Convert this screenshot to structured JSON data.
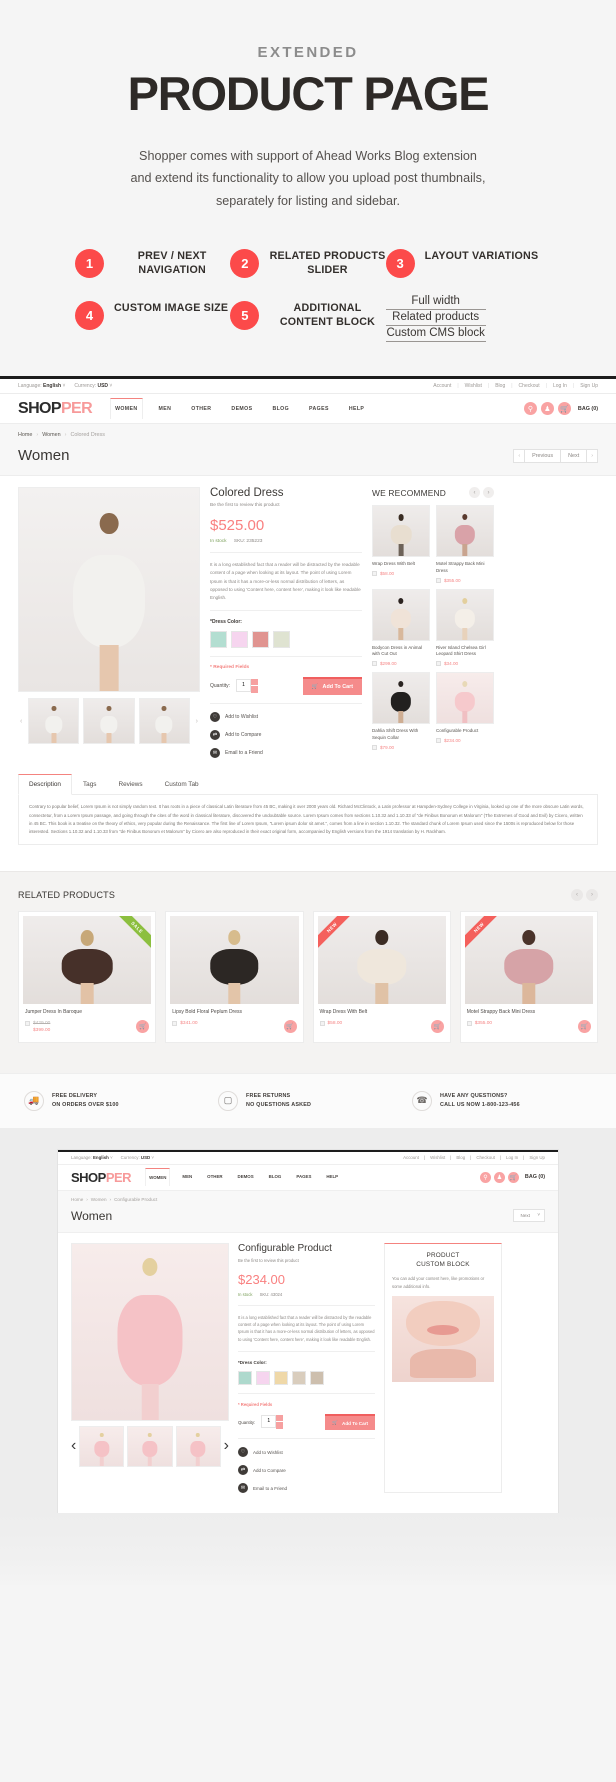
{
  "promo": {
    "kicker": "EXTENDED",
    "title": "PRODUCT PAGE",
    "subtitle_line1": "Shopper comes with support of Ahead Works Blog extension",
    "subtitle_line2": "and extend its functionality to allow you upload post thumbnails,",
    "subtitle_line3": "separately for listing and sidebar.",
    "features": [
      {
        "num": "1",
        "label": "PREV / NEXT NAVIGATION"
      },
      {
        "num": "2",
        "label": "RELATED PRODUCTS SLIDER"
      },
      {
        "num": "3",
        "label": "LAYOUT VARIATIONS"
      },
      {
        "num": "4",
        "label": "CUSTOM IMAGE SIZE"
      },
      {
        "num": "5",
        "label": "ADDITIONAL CONTENT BLOCK"
      }
    ],
    "layout_links": [
      "Full width",
      "Related products",
      "Custom CMS block"
    ],
    "accent_color": "#fc4a4a"
  },
  "shop": {
    "topbar": {
      "language_label": "Language:",
      "language_value": "English",
      "currency_label": "Currency:",
      "currency_value": "USD",
      "links": [
        "Account",
        "Wishlist",
        "Blog",
        "Checkout",
        "Log In",
        "Sign Up"
      ]
    },
    "logo_first": "SHOP",
    "logo_second": "PER",
    "nav": [
      "WOMEN",
      "MEN",
      "OTHER",
      "DEMOS",
      "BLOG",
      "PAGES",
      "HELP"
    ],
    "nav_active": "WOMEN",
    "header_icons": [
      "search-icon",
      "user-icon",
      "cart-icon"
    ],
    "bag_label": "BAG (0)",
    "breadcrumb": [
      "Home",
      "Women",
      "Colored Dress"
    ],
    "page_title": "Women",
    "pager": {
      "prev": "Previous",
      "next": "Next"
    },
    "product": {
      "name": "Colored Dress",
      "review_link": "Be the first to review this product",
      "price": "$525.00",
      "stock": "In stock",
      "sku": "SKU: 235223",
      "description": "It is a long established fact that a reader will be distracted by the readable content of a page when looking at its layout. The point of using Lorem Ipsum is that it has a more-or-less normal distribution of letters, as opposed to using 'Content here, content here', making it look like readable English.",
      "color_label": "*Dress Color:",
      "colors": [
        "#b3ded1",
        "#f6d5ef",
        "#e09490",
        "#dfe3d1"
      ],
      "required_note": "* Required Fields",
      "qty_label": "Quantity:",
      "qty_value": "1",
      "add_to_cart": "Add To Cart",
      "links": [
        {
          "icon": "heart-icon",
          "label": "Add to Wishlist"
        },
        {
          "icon": "compare-icon",
          "label": "Add to Compare"
        },
        {
          "icon": "mail-icon",
          "label": "Email to a Friend"
        }
      ]
    },
    "recommend": {
      "title": "WE RECOMMEND",
      "items": [
        {
          "name": "Wrap Dress With Belt",
          "price": "$58.00"
        },
        {
          "name": "Motel Strappy Back Mini Dress",
          "price": "$355.00"
        },
        {
          "name": "Bodycon Dress in Animal with Cut Out",
          "price": "$299.00"
        },
        {
          "name": "River Island Chelsea Girl Leopard Shirt Dress",
          "price": "$34.00"
        },
        {
          "name": "Dahlia Shift Dress With Sequin Collar",
          "price": "$79.00"
        },
        {
          "name": "Configurable Product",
          "price": "$234.00"
        }
      ]
    },
    "tabs": [
      "Description",
      "Tags",
      "Reviews",
      "Custom Tab"
    ],
    "tab_active": "Description",
    "tab_body": "Contrary to popular belief, Lorem Ipsum is not simply random text. It has roots in a piece of classical Latin literature from 45 BC, making it over 2000 years old. Richard McClintock, a Latin professor at Hampden-Sydney College in Virginia, looked up one of the more obscure Latin words, consectetur, from a Lorem Ipsum passage, and going through the cites of the word in classical literature, discovered the undoubtable source. Lorem Ipsum comes from sections 1.10.32 and 1.10.33 of \"de Finibus Bonorum et Malorum\" (The Extremes of Good and Evil) by Cicero, written in 45 BC. This book is a treatise on the theory of ethics, very popular during the Renaissance. The first line of Lorem Ipsum, \"Lorem ipsum dolor sit amet.\", comes from a line in section 1.10.32. The standard chunk of Lorem Ipsum used since the 1500s is reproduced below for those interested. Sections 1.10.32 and 1.10.33 from \"de Finibus Bonorum et Malorum\" by Cicero are also reproduced in their exact original form, accompanied by English versions from the 1914 translation by H. Rackham.",
    "related": {
      "title": "RELATED PRODUCTS",
      "items": [
        {
          "name": "Jumper Dress In Baroque",
          "price": "$399.00",
          "old_price": "$429.00",
          "badge": "SALE",
          "badge_type": "sale"
        },
        {
          "name": "Lipsy Bold Floral Peplum Dress",
          "price": "$341.00",
          "old_price": "",
          "badge": "",
          "badge_type": ""
        },
        {
          "name": "Wrap Dress With Belt",
          "price": "$58.00",
          "old_price": "",
          "badge": "NEW",
          "badge_type": "new"
        },
        {
          "name": "Motel Strappy Back Mini Dress",
          "price": "$355.00",
          "old_price": "",
          "badge": "NEW",
          "badge_type": "new"
        }
      ]
    },
    "services": [
      {
        "icon": "truck-icon",
        "line1": "FREE DELIVERY",
        "line2": "ON ORDERS OVER $100"
      },
      {
        "icon": "box-icon",
        "line1": "FREE RETURNS",
        "line2": "NO QUESTIONS ASKED"
      },
      {
        "icon": "phone-icon",
        "line1": "HAVE ANY QUESTIONS?",
        "line2": "CALL US NOW 1-800-123-456"
      }
    ]
  },
  "shop2": {
    "topbar": {
      "language_label": "Language:",
      "language_value": "English",
      "currency_label": "Currency:",
      "currency_value": "USD",
      "links": [
        "Account",
        "Wishlist",
        "Blog",
        "Checkout",
        "Log In",
        "Sign Up"
      ]
    },
    "logo_first": "SHOP",
    "logo_second": "PER",
    "nav": [
      "WOMEN",
      "MEN",
      "OTHER",
      "DEMOS",
      "BLOG",
      "PAGES",
      "HELP"
    ],
    "nav_active": "WOMEN",
    "bag_label": "BAG (0)",
    "breadcrumb": [
      "Home",
      "Women",
      "Configurable Product"
    ],
    "page_title": "Women",
    "sort_value": "Next",
    "product": {
      "name": "Configurable Product",
      "review_link": "Be the first to review this product",
      "price": "$234.00",
      "stock": "In stock",
      "sku": "SKU: 43024",
      "description": "It is a long established fact that a reader will be distracted by the readable content of a page when looking at its layout. The point of using Lorem Ipsum is that it has a more-or-less normal distribution of letters, as opposed to using 'Content here, content here', making it look like readable English.",
      "color_label": "*Dress Color:",
      "colors": [
        "#aed9cd",
        "#f6d5ef",
        "#efd8a8",
        "#d9cdbd",
        "#cdbfae"
      ],
      "required_note": "* Required Fields",
      "qty_label": "Quantity:",
      "qty_value": "1",
      "add_to_cart": "Add To Cart",
      "links": [
        {
          "icon": "heart-icon",
          "label": "Add to Wishlist"
        },
        {
          "icon": "compare-icon",
          "label": "Add to Compare"
        },
        {
          "icon": "mail-icon",
          "label": "Email to a Friend"
        }
      ]
    },
    "cms_block": {
      "title_line1": "PRODUCT",
      "title_line2": "CUSTOM BLOCK",
      "text": "You can add your content here, like promotions or some additional info."
    }
  }
}
